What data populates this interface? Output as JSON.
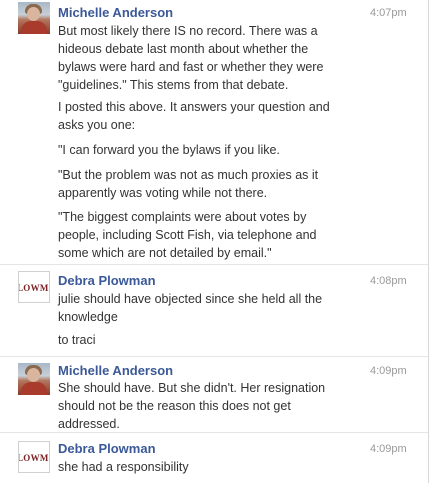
{
  "messages": [
    {
      "author": "Michelle Anderson",
      "time": "4:07pm",
      "avatar": "photo",
      "paragraphs": [
        "But most likely there IS no record. There was a\nhideous debate last month about whether the\nbylaws were hard and fast or whether they were\n\"guidelines.\" This stems from that debate.",
        "I posted this above. It answers your question and\nasks you one:",
        "\"I can forward you the bylaws if you like.",
        "\"But the problem was not as much proxies as it\napparently was voting while not there.",
        "\"The biggest complaints were about votes by\npeople, including Scott Fish, via telephone and\nsome which are not detailed by email.\""
      ]
    },
    {
      "author": "Debra Plowman",
      "time": "4:08pm",
      "avatar": "logo",
      "avatar_text": "LOWMA",
      "paragraphs": [
        "julie should have objected since she held all the\nknowledge",
        "to traci"
      ]
    },
    {
      "author": "Michelle Anderson",
      "time": "4:09pm",
      "avatar": "photo",
      "paragraphs": [
        "She should have. But she didn't. Her resignation\nshould not be the reason this does not get\naddressed."
      ]
    },
    {
      "author": "Debra Plowman",
      "time": "4:09pm",
      "avatar": "logo",
      "avatar_text": "LOWMA",
      "paragraphs": [
        "she had a responsibility"
      ]
    }
  ]
}
